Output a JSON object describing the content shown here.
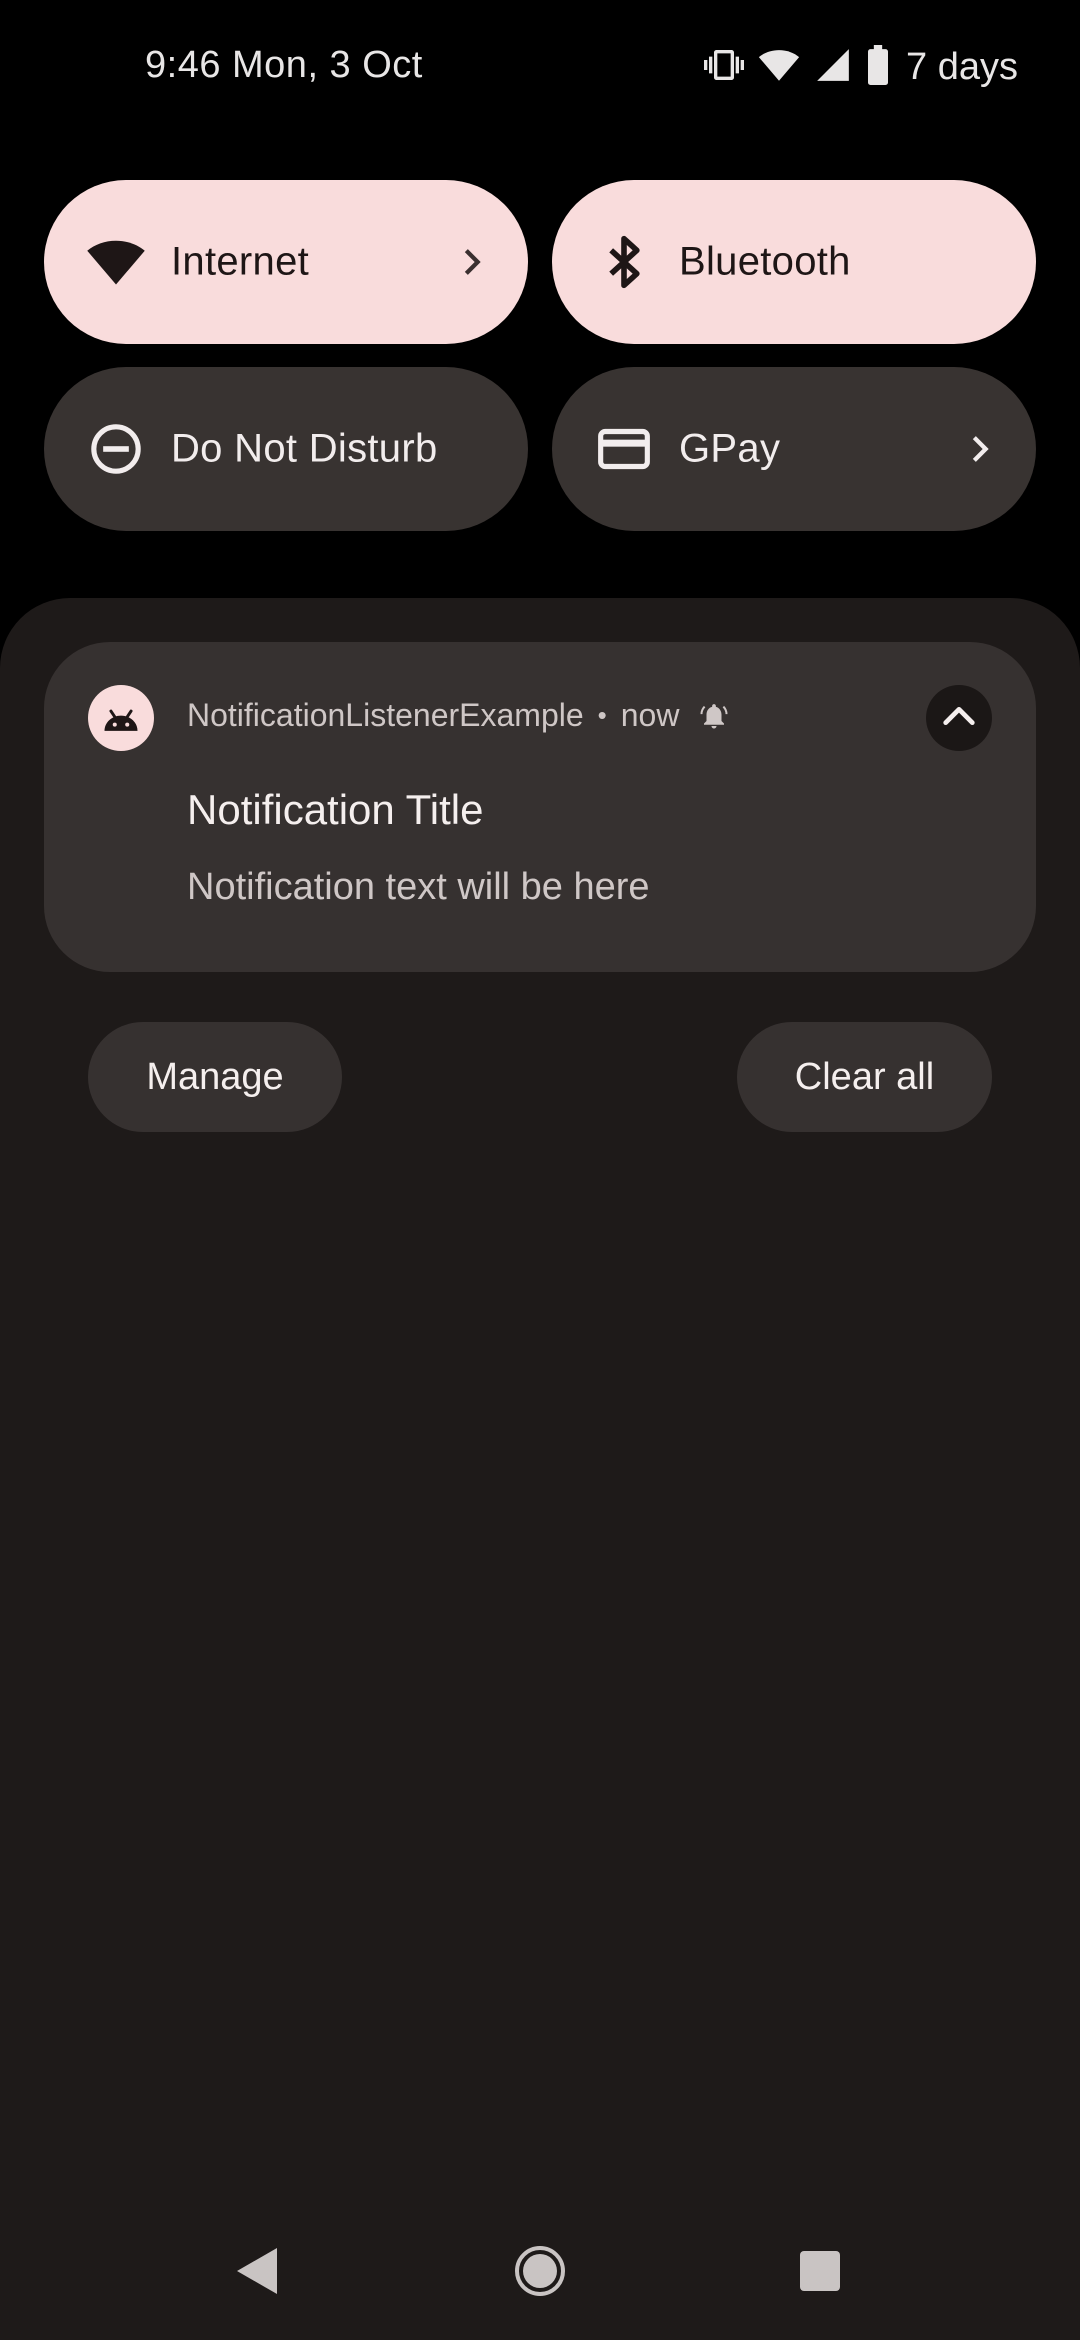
{
  "status_bar": {
    "time_date": "9:46  Mon, 3 Oct",
    "battery_text": "7 days",
    "icons": [
      "vibrate-icon",
      "wifi-icon",
      "cell-signal-icon",
      "battery-icon"
    ]
  },
  "quick_settings": {
    "tiles": [
      {
        "label": "Internet",
        "icon": "wifi-icon",
        "state": "on",
        "has_chevron": true
      },
      {
        "label": "Bluetooth",
        "icon": "bluetooth-icon",
        "state": "on",
        "has_chevron": false
      },
      {
        "label": "Do Not Disturb",
        "icon": "do-not-disturb-icon",
        "state": "off",
        "has_chevron": false
      },
      {
        "label": "GPay",
        "icon": "credit-card-icon",
        "state": "off",
        "has_chevron": true
      }
    ]
  },
  "notification": {
    "app_name": "NotificationListenerExample",
    "separator": "•",
    "time": "now",
    "title": "Notification Title",
    "text": "Notification text will be here",
    "app_icon": "android-icon",
    "alert_icon": "bell-icon",
    "expand_icon": "chevron-up-icon"
  },
  "footer": {
    "manage_label": "Manage",
    "clear_all_label": "Clear all"
  },
  "nav_bar": {
    "icons": [
      "back-icon",
      "home-icon",
      "recents-icon"
    ]
  },
  "colors": {
    "tile_on": "#f9dcdc",
    "tile_off": "#383331",
    "shade": "#1e1a19",
    "card": "#363130"
  }
}
